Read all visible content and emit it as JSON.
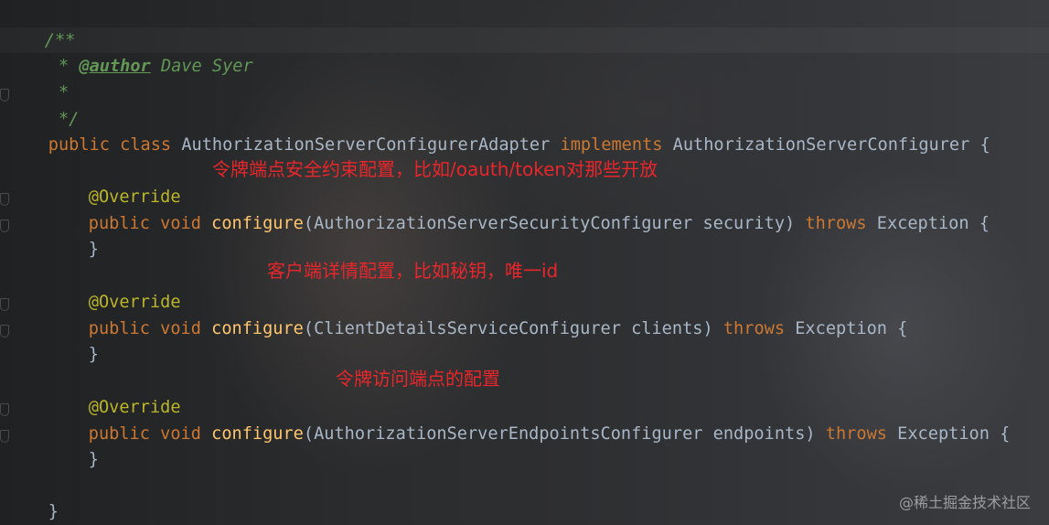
{
  "editor": {
    "lines": {
      "l1": "/**",
      "l2_star": " * ",
      "l2_tag": "@author",
      "l2_text": " Dave Syer",
      "l3": " *",
      "l4": " */",
      "l5_kw1": "public class ",
      "l5_name": "AuthorizationServerConfigurerAdapter ",
      "l5_kw2": "implements ",
      "l5_iface": "AuthorizationServerConfigurer {",
      "override": "@Override",
      "m1_kw": "public void ",
      "m1_fn": "configure",
      "m1_args": "(AuthorizationServerSecurityConfigurer security) ",
      "throws": "throws ",
      "exception": "Exception {",
      "m2_kw": "public void ",
      "m2_fn": "configure",
      "m2_args": "(ClientDetailsServiceConfigurer clients) ",
      "m3_kw": "public void ",
      "m3_fn": "configure",
      "m3_args": "(AuthorizationServerEndpointsConfigurer endpoints) ",
      "close_brace": "}"
    }
  },
  "annotations": {
    "note1": "令牌端点安全约束配置，比如/oauth/token对那些开放",
    "note2": "客户端详情配置，比如秘钥，唯一id",
    "note3": "令牌访问端点的配置"
  },
  "watermark": "@稀土掘金技术社区",
  "colors": {
    "keyword": "#cc7832",
    "annotation": "#bbb529",
    "method": "#ffc66d",
    "comment": "#629755",
    "text": "#a9b7c6",
    "note_red": "#e8262b"
  }
}
